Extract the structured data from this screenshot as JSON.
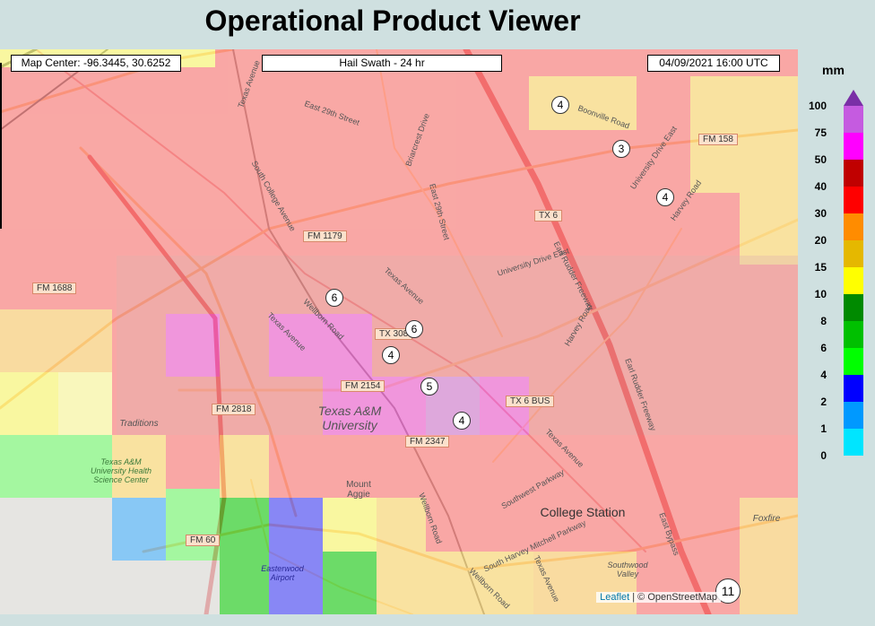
{
  "title": "Operational Product Viewer",
  "map": {
    "center_label": "Map Center: -96.3445, 30.6252",
    "product_label": "Hail Swath - 24 hr",
    "datetime_label": "04/09/2021   16:00 UTC",
    "attribution": {
      "leaflet": "Leaflet",
      "sep": " | ",
      "osm": "© OpenStreetMap"
    },
    "road_labels": [
      "FM 158",
      "TX 6",
      "FM 1179",
      "FM 1688",
      "TX 308",
      "FM 2154",
      "TX 6 BUS",
      "FM 2818",
      "FM 2347",
      "FM 60"
    ],
    "streets": [
      "East 29th Street",
      "Texas Avenue",
      "South College Avenue",
      "Briarcrest Drive",
      "East 29th Street",
      "Boonville Road",
      "University Drive East",
      "Harvey Road",
      "Earl Rudder Freeway",
      "University Drive East",
      "Texas Avenue",
      "Wellborn Road",
      "Harvey Road",
      "Earl Rudder Freeway",
      "Texas Avenue",
      "Southwest Parkway",
      "Wellborn Road",
      "South Harvey Mitchell Parkway",
      "Texas Avenue",
      "Wellborn Road",
      "East Bypass",
      "Texas Avenue"
    ],
    "places": [
      "Texas A&M University",
      "College Station",
      "Traditions",
      "Texas A&M University Health Science Center",
      "Mount Aggie",
      "Easterwood Airport",
      "Southwood Valley",
      "Foxfire"
    ],
    "markers": [
      "4",
      "3",
      "4",
      "6",
      "6",
      "4",
      "5",
      "4",
      "11"
    ]
  },
  "legend": {
    "unit": "mm",
    "labels": [
      "100",
      "75",
      "50",
      "40",
      "30",
      "20",
      "15",
      "10",
      "8",
      "6",
      "4",
      "2",
      "1",
      "0"
    ],
    "colors": [
      "#7a2fa6",
      "#c55be0",
      "#ff00ff",
      "#c00000",
      "#ff0000",
      "#ff8c00",
      "#e5b800",
      "#ffff00",
      "#008a00",
      "#00c000",
      "#00ff00",
      "#0000ff",
      "#0099ff",
      "#00e5ff"
    ]
  }
}
